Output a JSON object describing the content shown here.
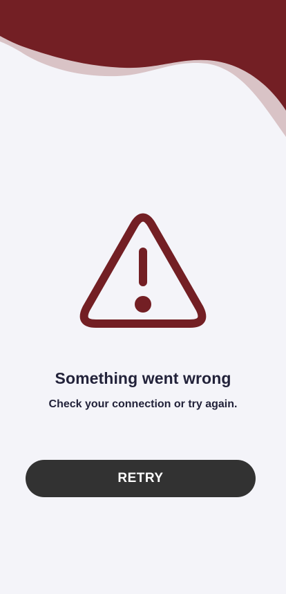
{
  "colors": {
    "accent": "#731f24",
    "accent_light": "#d9c3c6",
    "background": "#f4f4f9",
    "text": "#22223a",
    "button": "#323232"
  },
  "decoration": {
    "header": "wave-decoration"
  },
  "icon": {
    "name": "warning-icon"
  },
  "error": {
    "title": "Something went wrong",
    "message": "Check your connection or try again."
  },
  "actions": {
    "retry_label": "RETRY"
  }
}
